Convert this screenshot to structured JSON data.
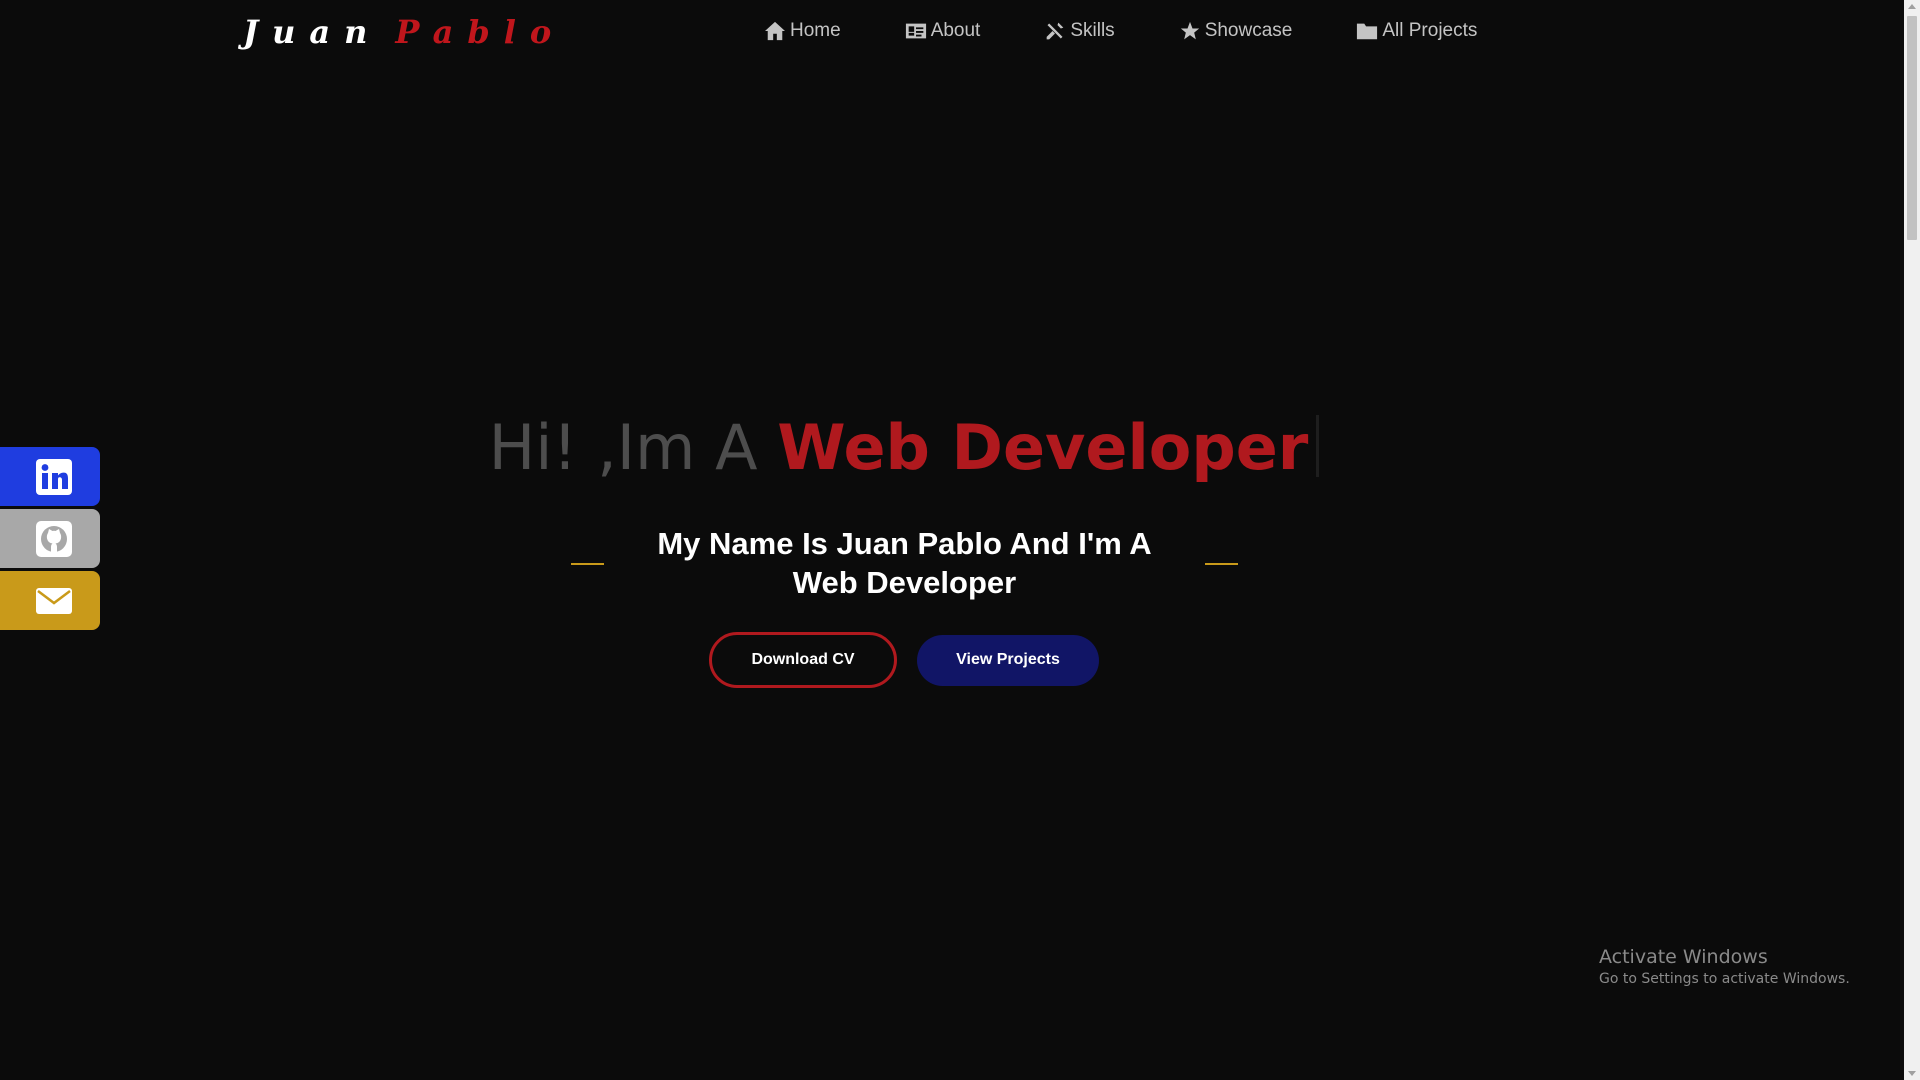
{
  "header": {
    "logo_first": "Juan",
    "logo_last": "Pablo",
    "nav": [
      {
        "label": "Home",
        "icon": "home-icon"
      },
      {
        "label": "About",
        "icon": "id-card-icon"
      },
      {
        "label": "Skills",
        "icon": "tools-icon"
      },
      {
        "label": "Showcase",
        "icon": "star-icon"
      },
      {
        "label": "All Projects",
        "icon": "folder-icon"
      }
    ]
  },
  "social": [
    {
      "icon": "linkedin-icon",
      "color": "#1f3de0"
    },
    {
      "icon": "github-icon",
      "color": "#a8a8a8"
    },
    {
      "icon": "envelope-icon",
      "color": "#c99a1a"
    }
  ],
  "hero": {
    "greeting": "Hi! ,Im A",
    "role": "Web Developer",
    "subtitle": "My Name Is Juan Pablo And I'm A Web Developer",
    "download_cv": "Download CV",
    "view_projects": "View Projects"
  },
  "colors": {
    "background": "#0b0b0b",
    "accent_red": "#b0191e",
    "accent_gold": "#c99a1a",
    "button_navy": "#111566"
  },
  "watermark": {
    "title": "Activate Windows",
    "subtitle": "Go to Settings to activate Windows."
  }
}
